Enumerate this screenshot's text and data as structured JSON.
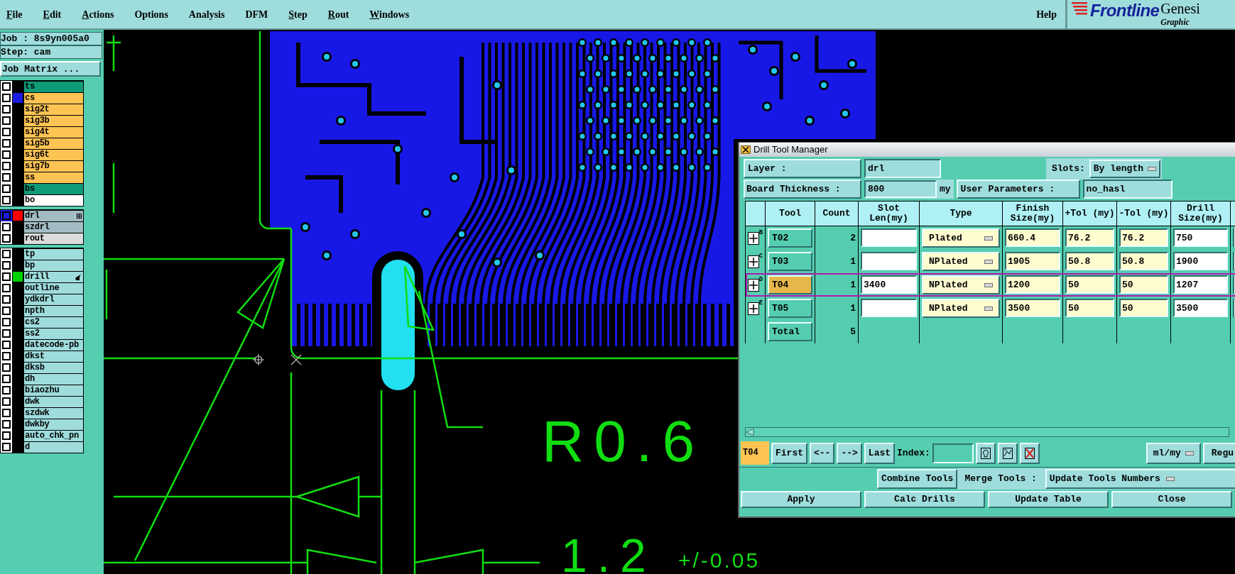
{
  "menu": [
    {
      "label": "File",
      "underlined": true
    },
    {
      "label": "Edit",
      "underlined": true
    },
    {
      "label": "Actions",
      "underlined": true
    },
    {
      "label": "Options",
      "underlined": false
    },
    {
      "label": "Analysis",
      "underlined": false
    },
    {
      "label": "DFM",
      "underlined": false
    },
    {
      "label": "Step",
      "underlined": true
    },
    {
      "label": "Rout",
      "underlined": true
    },
    {
      "label": "Windows",
      "underlined": true
    }
  ],
  "help": "Help",
  "logo": {
    "brand": "Frontline",
    "product": "Genesi",
    "tagline": "Graphic"
  },
  "job": "Job : 8s9yn005a0",
  "step": "Step: cam",
  "job_matrix_button": "Job Matrix ...",
  "layer_groups": [
    [
      {
        "name": "ts",
        "kind": "mask",
        "selected": false,
        "work": false
      },
      {
        "name": "cs",
        "kind": "signal",
        "color": "#1c1ce0",
        "selected": false,
        "work": false
      },
      {
        "name": "sig2t",
        "kind": "signal",
        "selected": false,
        "work": false
      },
      {
        "name": "sig3b",
        "kind": "signal",
        "selected": false,
        "work": false
      },
      {
        "name": "sig4t",
        "kind": "signal",
        "selected": false,
        "work": false
      },
      {
        "name": "sig5b",
        "kind": "signal",
        "selected": false,
        "work": false
      },
      {
        "name": "sig6t",
        "kind": "signal",
        "selected": false,
        "work": false
      },
      {
        "name": "sig7b",
        "kind": "signal",
        "selected": false,
        "work": false
      },
      {
        "name": "ss",
        "kind": "signal",
        "selected": false,
        "work": false
      },
      {
        "name": "bs",
        "kind": "mask",
        "selected": false,
        "work": false
      },
      {
        "name": "bo",
        "kind": "document",
        "selected": false,
        "work": false
      }
    ],
    [
      {
        "name": "drl",
        "kind": "drill",
        "color": "#ff0000",
        "selected": true,
        "work": false
      },
      {
        "name": "szdrl",
        "kind": "drill",
        "selected": false,
        "work": false
      },
      {
        "name": "rout",
        "kind": "rout",
        "selected": false,
        "work": false
      }
    ],
    [
      {
        "name": "tp",
        "kind": "misc",
        "selected": false,
        "work": false
      },
      {
        "name": "bp",
        "kind": "misc",
        "selected": false,
        "work": false
      },
      {
        "name": "drill",
        "kind": "misc",
        "color": "#00d000",
        "selected": false,
        "work": true
      },
      {
        "name": "outline",
        "kind": "misc",
        "selected": false,
        "work": false
      },
      {
        "name": "ydkdrl",
        "kind": "misc",
        "selected": false,
        "work": false
      },
      {
        "name": "npth",
        "kind": "misc",
        "selected": false,
        "work": false
      },
      {
        "name": "cs2",
        "kind": "misc",
        "selected": false,
        "work": false
      },
      {
        "name": "ss2",
        "kind": "misc",
        "selected": false,
        "work": false
      },
      {
        "name": "datecode-pb",
        "kind": "misc",
        "selected": false,
        "work": false
      },
      {
        "name": "dkst",
        "kind": "misc",
        "selected": false,
        "work": false
      },
      {
        "name": "dksb",
        "kind": "misc",
        "selected": false,
        "work": false
      },
      {
        "name": "dh",
        "kind": "misc",
        "selected": false,
        "work": false
      },
      {
        "name": "biaozhu",
        "kind": "misc",
        "selected": false,
        "work": false
      },
      {
        "name": "dwk",
        "kind": "misc",
        "selected": false,
        "work": false
      },
      {
        "name": "szdwk",
        "kind": "misc",
        "selected": false,
        "work": false
      },
      {
        "name": "dwkby",
        "kind": "misc",
        "selected": false,
        "work": false
      },
      {
        "name": "auto_chk_pn",
        "kind": "misc",
        "selected": false,
        "work": false
      },
      {
        "name": "d",
        "kind": "misc",
        "selected": false,
        "work": false
      }
    ]
  ],
  "canvas": {
    "dimension_texts": [
      {
        "text": "R0.6",
        "kind": "large"
      },
      {
        "text": "1.2",
        "kind": "large"
      },
      {
        "text": "+/-0.05",
        "kind": "small"
      }
    ]
  },
  "dialog": {
    "title": "Drill Tool Manager",
    "layer_label": "Layer :",
    "layer_value": "drl",
    "slots_label": "Slots:",
    "slots_value": "By length",
    "thickness_label": "Board Thickness :",
    "thickness_value": "800",
    "thickness_unit": "my",
    "user_params_button": "User Parameters :",
    "user_params_value": "no_hasl",
    "columns": [
      "Tool",
      "Count",
      "Slot Len(my)",
      "Type",
      "Finish Size(my)",
      "+Tol (my)",
      "-Tol (my)",
      "Drill Size(my)"
    ],
    "rows": [
      {
        "mark": "B",
        "tool": "T02",
        "count": "2",
        "type": "Plated",
        "finish": "660.4",
        "plus_tol": "76.2",
        "minus_tol": "76.2",
        "drill": "750",
        "selected": false
      },
      {
        "mark": "C",
        "tool": "T03",
        "count": "1",
        "type": "NPlated",
        "finish": "1905",
        "plus_tol": "50.8",
        "minus_tol": "50.8",
        "drill": "1900",
        "selected": false
      },
      {
        "mark": "D",
        "tool": "T04",
        "count": "1",
        "slot_len": "3400",
        "type": "NPlated",
        "finish": "1200",
        "plus_tol": "50",
        "minus_tol": "50",
        "drill": "1207",
        "selected": true
      },
      {
        "mark": "E",
        "tool": "T05",
        "count": "1",
        "type": "NPlated",
        "finish": "3500",
        "plus_tol": "50",
        "minus_tol": "50",
        "drill": "3500",
        "selected": false
      }
    ],
    "total_label": "Total",
    "total_count": "5",
    "current_tool": "T04",
    "nav_buttons": [
      "First",
      "<--",
      "-->",
      "Last"
    ],
    "index_label": "Index:",
    "units_value": "ml/my",
    "regu_button": "Regu",
    "combine_button": "Combine Tools",
    "merge_label": "Merge Tools :",
    "merge_value": "Update Tools Numbers",
    "bottom_buttons": [
      "Apply",
      "Calc Drills",
      "Update Table",
      "Close"
    ]
  }
}
